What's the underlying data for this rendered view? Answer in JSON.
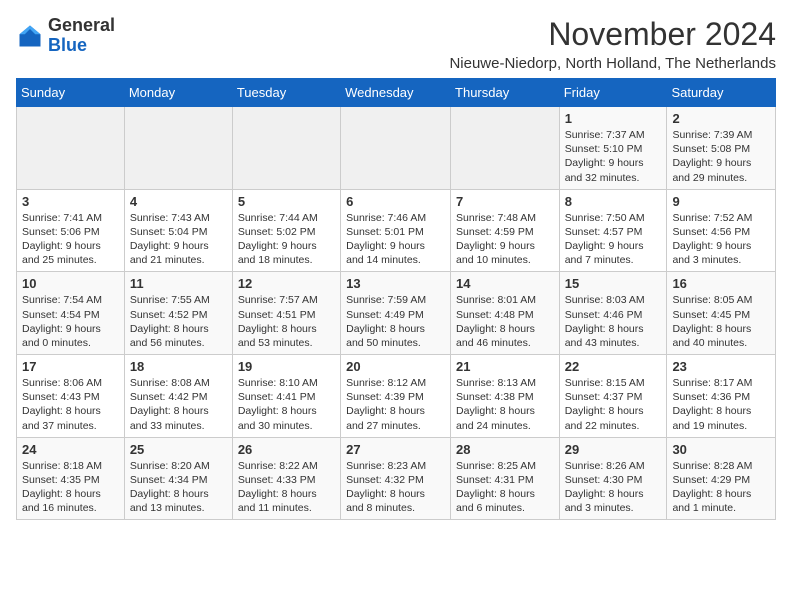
{
  "logo": {
    "general": "General",
    "blue": "Blue"
  },
  "title": "November 2024",
  "location": "Nieuwe-Niedorp, North Holland, The Netherlands",
  "weekdays": [
    "Sunday",
    "Monday",
    "Tuesday",
    "Wednesday",
    "Thursday",
    "Friday",
    "Saturday"
  ],
  "weeks": [
    [
      {
        "day": "",
        "info": ""
      },
      {
        "day": "",
        "info": ""
      },
      {
        "day": "",
        "info": ""
      },
      {
        "day": "",
        "info": ""
      },
      {
        "day": "",
        "info": ""
      },
      {
        "day": "1",
        "info": "Sunrise: 7:37 AM\nSunset: 5:10 PM\nDaylight: 9 hours and 32 minutes."
      },
      {
        "day": "2",
        "info": "Sunrise: 7:39 AM\nSunset: 5:08 PM\nDaylight: 9 hours and 29 minutes."
      }
    ],
    [
      {
        "day": "3",
        "info": "Sunrise: 7:41 AM\nSunset: 5:06 PM\nDaylight: 9 hours and 25 minutes."
      },
      {
        "day": "4",
        "info": "Sunrise: 7:43 AM\nSunset: 5:04 PM\nDaylight: 9 hours and 21 minutes."
      },
      {
        "day": "5",
        "info": "Sunrise: 7:44 AM\nSunset: 5:02 PM\nDaylight: 9 hours and 18 minutes."
      },
      {
        "day": "6",
        "info": "Sunrise: 7:46 AM\nSunset: 5:01 PM\nDaylight: 9 hours and 14 minutes."
      },
      {
        "day": "7",
        "info": "Sunrise: 7:48 AM\nSunset: 4:59 PM\nDaylight: 9 hours and 10 minutes."
      },
      {
        "day": "8",
        "info": "Sunrise: 7:50 AM\nSunset: 4:57 PM\nDaylight: 9 hours and 7 minutes."
      },
      {
        "day": "9",
        "info": "Sunrise: 7:52 AM\nSunset: 4:56 PM\nDaylight: 9 hours and 3 minutes."
      }
    ],
    [
      {
        "day": "10",
        "info": "Sunrise: 7:54 AM\nSunset: 4:54 PM\nDaylight: 9 hours and 0 minutes."
      },
      {
        "day": "11",
        "info": "Sunrise: 7:55 AM\nSunset: 4:52 PM\nDaylight: 8 hours and 56 minutes."
      },
      {
        "day": "12",
        "info": "Sunrise: 7:57 AM\nSunset: 4:51 PM\nDaylight: 8 hours and 53 minutes."
      },
      {
        "day": "13",
        "info": "Sunrise: 7:59 AM\nSunset: 4:49 PM\nDaylight: 8 hours and 50 minutes."
      },
      {
        "day": "14",
        "info": "Sunrise: 8:01 AM\nSunset: 4:48 PM\nDaylight: 8 hours and 46 minutes."
      },
      {
        "day": "15",
        "info": "Sunrise: 8:03 AM\nSunset: 4:46 PM\nDaylight: 8 hours and 43 minutes."
      },
      {
        "day": "16",
        "info": "Sunrise: 8:05 AM\nSunset: 4:45 PM\nDaylight: 8 hours and 40 minutes."
      }
    ],
    [
      {
        "day": "17",
        "info": "Sunrise: 8:06 AM\nSunset: 4:43 PM\nDaylight: 8 hours and 37 minutes."
      },
      {
        "day": "18",
        "info": "Sunrise: 8:08 AM\nSunset: 4:42 PM\nDaylight: 8 hours and 33 minutes."
      },
      {
        "day": "19",
        "info": "Sunrise: 8:10 AM\nSunset: 4:41 PM\nDaylight: 8 hours and 30 minutes."
      },
      {
        "day": "20",
        "info": "Sunrise: 8:12 AM\nSunset: 4:39 PM\nDaylight: 8 hours and 27 minutes."
      },
      {
        "day": "21",
        "info": "Sunrise: 8:13 AM\nSunset: 4:38 PM\nDaylight: 8 hours and 24 minutes."
      },
      {
        "day": "22",
        "info": "Sunrise: 8:15 AM\nSunset: 4:37 PM\nDaylight: 8 hours and 22 minutes."
      },
      {
        "day": "23",
        "info": "Sunrise: 8:17 AM\nSunset: 4:36 PM\nDaylight: 8 hours and 19 minutes."
      }
    ],
    [
      {
        "day": "24",
        "info": "Sunrise: 8:18 AM\nSunset: 4:35 PM\nDaylight: 8 hours and 16 minutes."
      },
      {
        "day": "25",
        "info": "Sunrise: 8:20 AM\nSunset: 4:34 PM\nDaylight: 8 hours and 13 minutes."
      },
      {
        "day": "26",
        "info": "Sunrise: 8:22 AM\nSunset: 4:33 PM\nDaylight: 8 hours and 11 minutes."
      },
      {
        "day": "27",
        "info": "Sunrise: 8:23 AM\nSunset: 4:32 PM\nDaylight: 8 hours and 8 minutes."
      },
      {
        "day": "28",
        "info": "Sunrise: 8:25 AM\nSunset: 4:31 PM\nDaylight: 8 hours and 6 minutes."
      },
      {
        "day": "29",
        "info": "Sunrise: 8:26 AM\nSunset: 4:30 PM\nDaylight: 8 hours and 3 minutes."
      },
      {
        "day": "30",
        "info": "Sunrise: 8:28 AM\nSunset: 4:29 PM\nDaylight: 8 hours and 1 minute."
      }
    ]
  ]
}
